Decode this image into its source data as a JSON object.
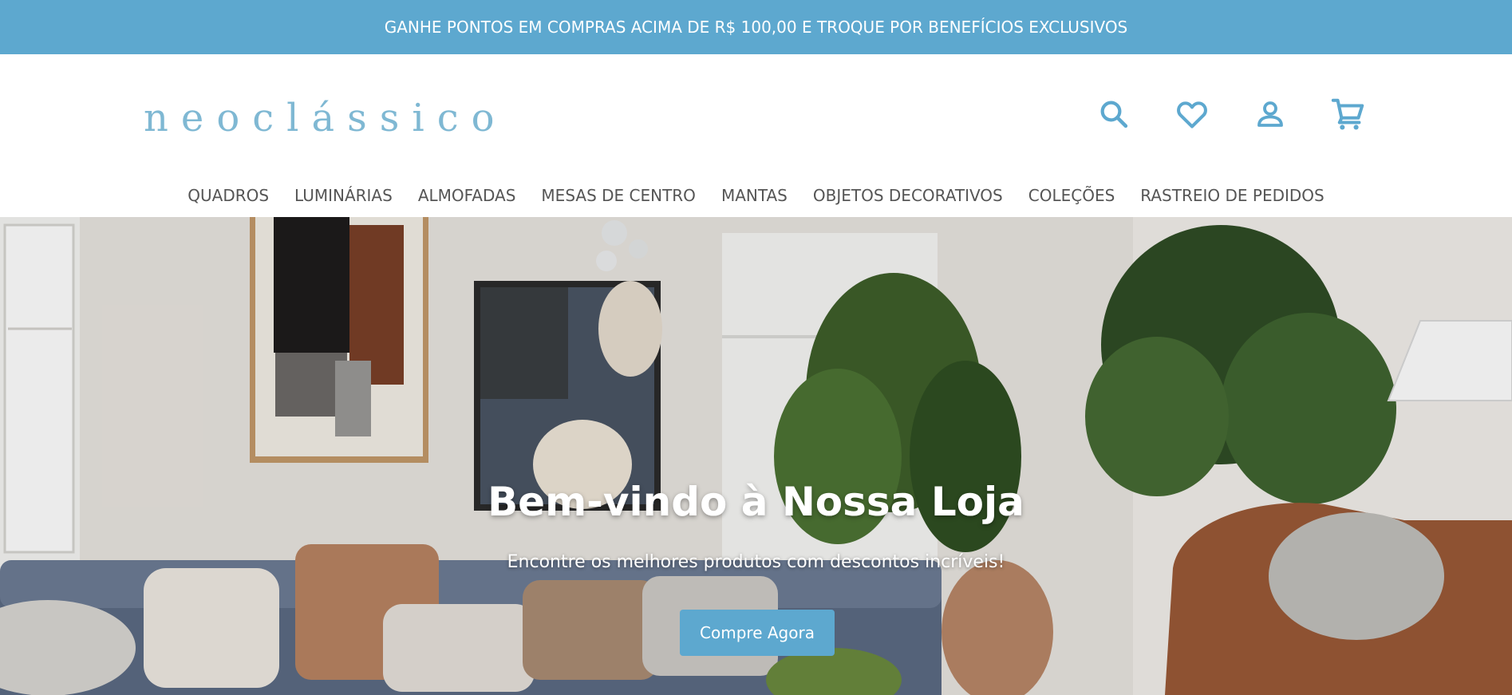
{
  "announcement": {
    "text": "GANHE PONTOS EM COMPRAS ACIMA DE R$ 100,00 E TROQUE POR BENEFÍCIOS EXCLUSIVOS"
  },
  "header": {
    "logo": "neoclássico",
    "icons": [
      "search-icon",
      "heart-icon",
      "user-icon",
      "cart-icon"
    ]
  },
  "nav": {
    "items": [
      "QUADROS",
      "LUMINÁRIAS",
      "ALMOFADAS",
      "MESAS DE CENTRO",
      "MANTAS",
      "OBJETOS DECORATIVOS",
      "COLEÇÕES",
      "RASTREIO DE PEDIDOS"
    ]
  },
  "hero": {
    "title": "Bem-vindo à Nossa Loja",
    "subtitle": "Encontre os melhores produtos com descontos incríveis!",
    "button_label": "Compre Agora"
  },
  "colors": {
    "brand_blue": "#5da8cf",
    "logo_blue": "#7fb8d3",
    "nav_text": "#555555"
  }
}
